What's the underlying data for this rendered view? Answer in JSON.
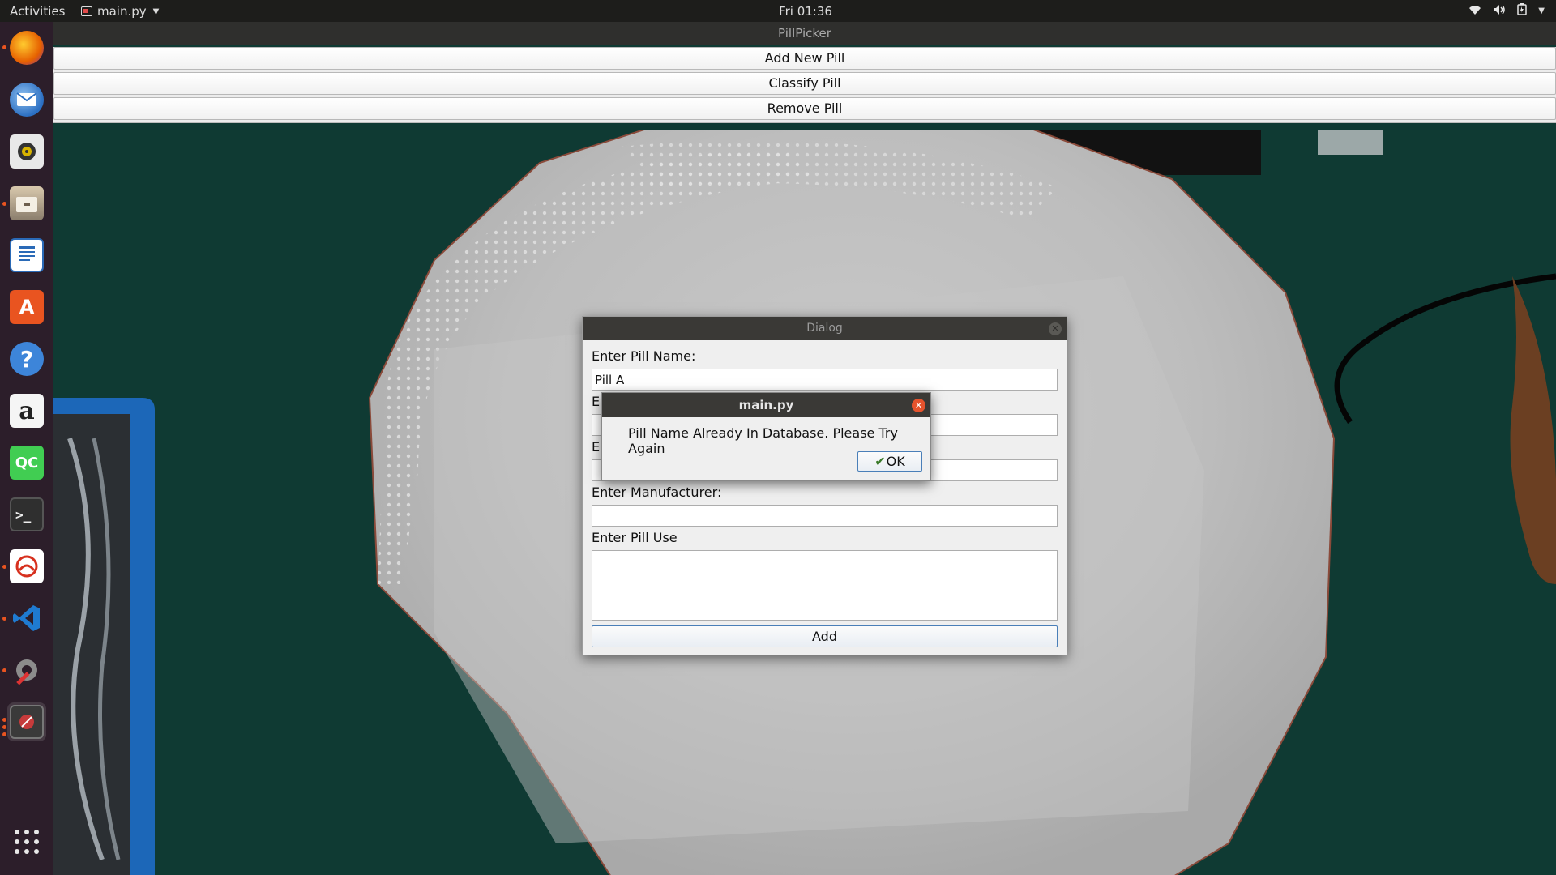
{
  "topbar": {
    "activities": "Activities",
    "app_name": "main.py",
    "clock": "Fri 01:36",
    "tray_icons": [
      "wifi-icon",
      "volume-icon",
      "battery-icon",
      "chevron-down-icon"
    ]
  },
  "dock": {
    "items": [
      {
        "name": "firefox",
        "icon": "firefox-icon",
        "color": "#e66000"
      },
      {
        "name": "thunderbird",
        "icon": "mail-icon",
        "color": "#2b6fc2"
      },
      {
        "name": "rhythmbox",
        "icon": "speaker-icon",
        "color": "#d9d9d9"
      },
      {
        "name": "files",
        "icon": "files-icon",
        "color": "#8a7d6c"
      },
      {
        "name": "libreoffice-writer",
        "icon": "writer-icon",
        "color": "#2a6ab7"
      },
      {
        "name": "ubuntu-software",
        "icon": "software-center-icon",
        "color": "#e95420"
      },
      {
        "name": "help",
        "icon": "help-icon",
        "color": "#3d85d9"
      },
      {
        "name": "amazon",
        "icon": "amazon-icon",
        "color": "#f2f2f2"
      },
      {
        "name": "qtcreator",
        "icon": "qtcreator-icon",
        "color": "#41cd52",
        "label": "QC"
      },
      {
        "name": "terminal",
        "icon": "terminal-icon",
        "color": "#2f2f2f"
      },
      {
        "name": "document-viewer",
        "icon": "document-viewer-icon",
        "color": "#d7301e"
      },
      {
        "name": "vscode",
        "icon": "vscode-icon",
        "color": "#1f7bd1"
      },
      {
        "name": "settings",
        "icon": "settings-icon",
        "color": "#7a7a7a"
      },
      {
        "name": "main-py-window",
        "icon": "app-window-icon",
        "color": "#c63b3b"
      }
    ],
    "show_apps_icon": "show-applications-icon"
  },
  "main_window": {
    "title": "PillPicker",
    "buttons": [
      "Add New Pill",
      "Classify Pill",
      "Remove Pill"
    ]
  },
  "dialog": {
    "title": "Dialog",
    "pill_name_label": "Enter Pill Name:",
    "pill_name_value": "Pill A",
    "field2_label_partial": "En",
    "field3_label_partial": "En",
    "manufacturer_label": "Enter Manufacturer:",
    "pill_use_label": "Enter Pill Use",
    "add_button": "Add"
  },
  "message_box": {
    "title": "main.py",
    "message": "Pill Name Already In Database. Please Try Again",
    "ok_button": "OK"
  }
}
